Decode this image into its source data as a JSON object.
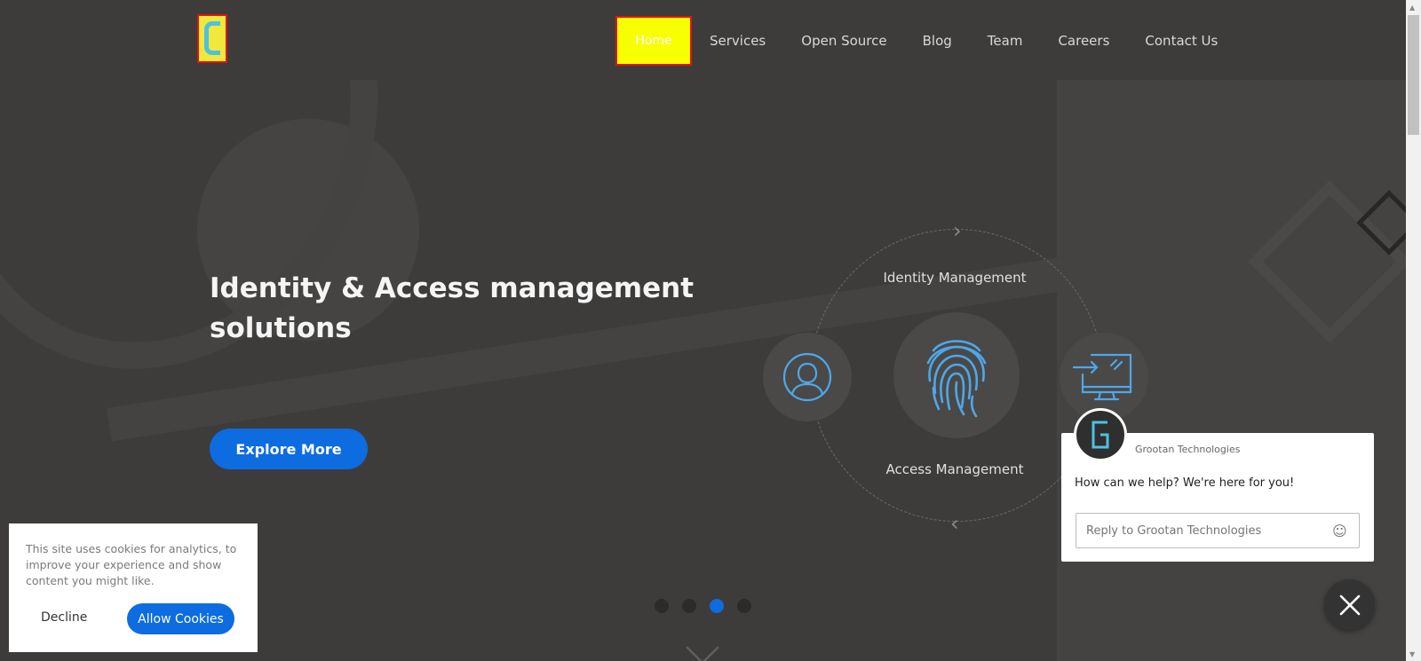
{
  "nav": {
    "items": [
      {
        "label": "Home",
        "active": true
      },
      {
        "label": "Services"
      },
      {
        "label": "Open Source"
      },
      {
        "label": "Blog"
      },
      {
        "label": "Team"
      },
      {
        "label": "Careers"
      },
      {
        "label": "Contact Us"
      }
    ]
  },
  "hero": {
    "title": "Identity & Access management solutions",
    "cta_label": "Explore More"
  },
  "diagram": {
    "top_label": "Identity Management",
    "bottom_label": "Access Management",
    "icons": [
      "user-icon",
      "fingerprint-icon",
      "monitor-login-icon"
    ]
  },
  "carousel": {
    "slide_count": 4,
    "active_index": 2
  },
  "cookie": {
    "text": "This site uses cookies for analytics, to improve your experience and show content you might like.",
    "decline_label": "Decline",
    "allow_label": "Allow Cookies"
  },
  "chat": {
    "company": "Grootan Technologies",
    "message": "How can we help? We're here for you!",
    "placeholder": "Reply to Grootan Technologies"
  },
  "colors": {
    "accent": "#0d6ce0",
    "background": "#3d3c3b",
    "icon": "#4ea8e8"
  }
}
